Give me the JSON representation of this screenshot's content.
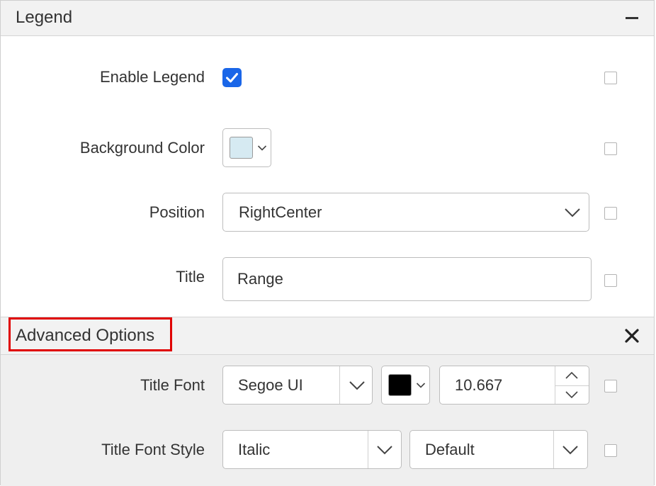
{
  "legend_section": {
    "title": "Legend"
  },
  "enable_legend": {
    "label": "Enable Legend",
    "checked": true
  },
  "background_color": {
    "label": "Background Color",
    "color": "#d6eaf2"
  },
  "position": {
    "label": "Position",
    "value": "RightCenter"
  },
  "title": {
    "label": "Title",
    "value": "Range"
  },
  "advanced_section": {
    "title": "Advanced Options"
  },
  "title_font": {
    "label": "Title Font",
    "font_name": "Segoe UI",
    "font_color": "#000000",
    "font_size": "10.667"
  },
  "title_font_style": {
    "label": "Title Font Style",
    "style": "Italic",
    "weight": "Default"
  },
  "colors": {
    "checkbox_accent": "#1a66e8",
    "highlight_border": "#e00000"
  }
}
